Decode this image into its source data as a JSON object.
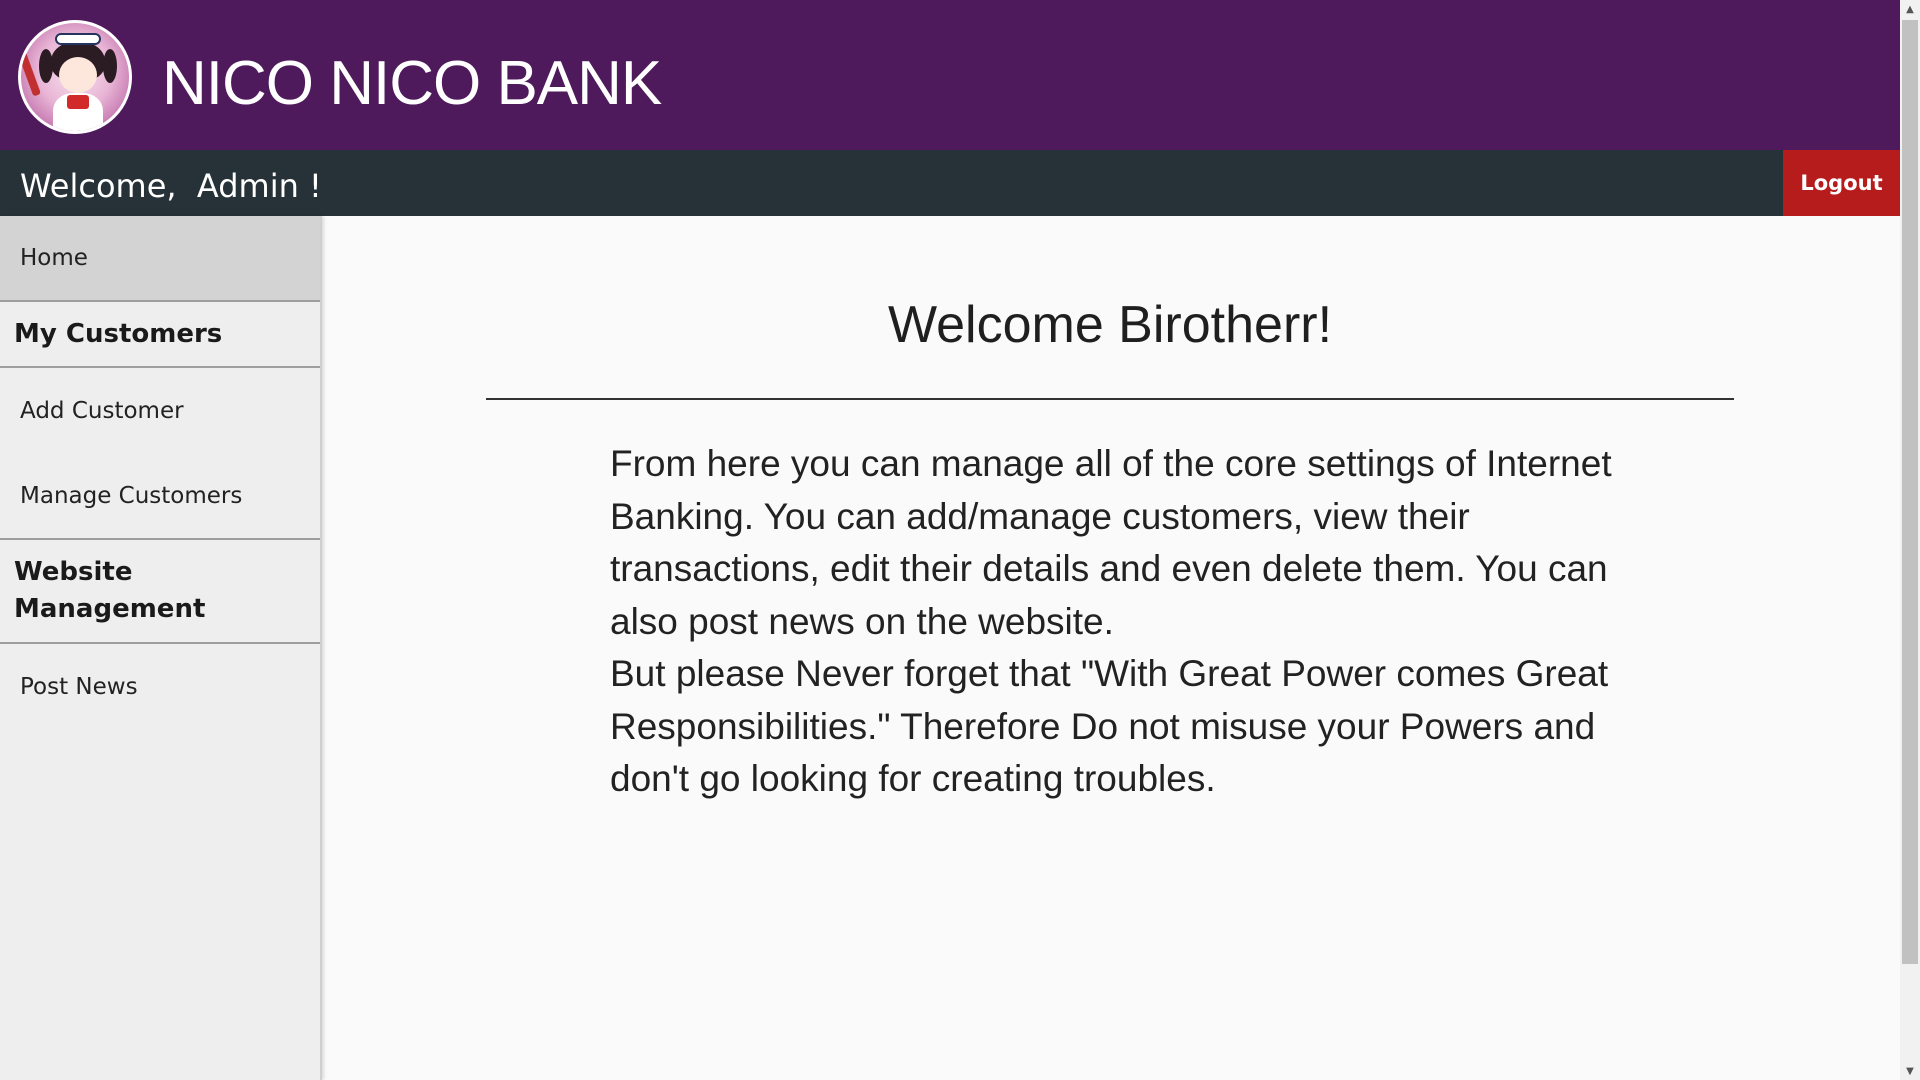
{
  "header": {
    "brand": "NICO NICO BANK",
    "logo_icon": "bank-mascot-logo-icon"
  },
  "topbar": {
    "welcome": "Welcome,  Admin !",
    "logout_label": "Logout"
  },
  "sidebar": {
    "home": "Home",
    "sections": [
      {
        "heading": "My Customers",
        "items": [
          "Add Customer",
          "Manage Customers"
        ]
      },
      {
        "heading": "Website Management",
        "items": [
          "Post News"
        ]
      }
    ]
  },
  "main": {
    "title": "Welcome Birotherr!",
    "paragraph_1": "From here you can manage all of the core settings of Internet Banking. You can add/manage customers, view their transactions, edit their details and even delete them. You can also post news on the website.",
    "paragraph_2": "But please Never forget that \"With Great Power comes Great Responsibilities.\" Therefore Do not misuse your Powers and don't go looking for creating troubles."
  },
  "colors": {
    "header_bg": "#4f1a5c",
    "topbar_bg": "#263238",
    "logout_bg": "#b71c1c",
    "sidebar_bg": "#eeeeee",
    "active_item_bg": "#d3d3d3"
  }
}
